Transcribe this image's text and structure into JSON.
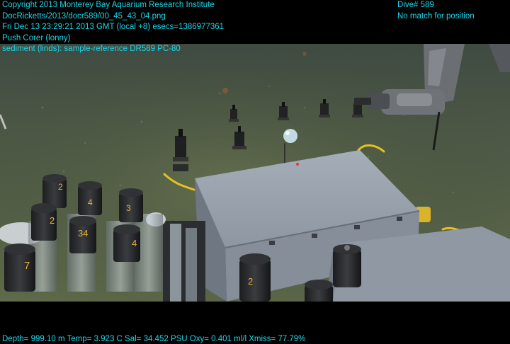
{
  "overlay": {
    "header_lines": [
      "Copyright 2013 Monterey Bay Aquarium Research Institute",
      "DocRicketts/2013/docr589/00_45_43_04.png",
      "Fri Dec 13 23:29:21 2013 GMT (local +8)  esecs=1386977361",
      "Push Corer (lonny)",
      "sediment (linds): sample-reference DR589 PC-80"
    ],
    "dive": "Dive# 589",
    "position": "No match for position",
    "footer": "Depth= 999.10 m  Temp= 3.923 C  Sal= 34.452 PSU  Oxy= 0.401 ml/l  Xmiss= 77.79%"
  },
  "colors": {
    "overlay_text": "#19d7ea",
    "water": "#3b4a3f",
    "seafloor": "#5a6547",
    "box_gray": "#9aa3ad"
  },
  "scene": {
    "core_labels": [
      "2",
      "4",
      "3",
      "34",
      "2",
      "4",
      "7",
      "2"
    ]
  }
}
